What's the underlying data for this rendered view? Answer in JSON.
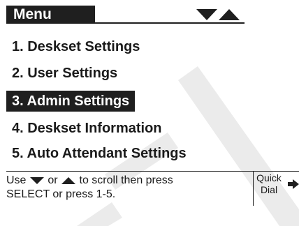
{
  "header": {
    "title": "Menu"
  },
  "menu": {
    "items": [
      {
        "label": "1. Deskset Settings",
        "selected": false
      },
      {
        "label": "2. User Settings",
        "selected": false
      },
      {
        "label": "3. Admin Settings",
        "selected": true
      },
      {
        "label": "4. Deskset Information",
        "selected": false
      },
      {
        "label": "5. Auto Attendant Settings",
        "selected": false
      }
    ]
  },
  "hint": {
    "use": "Use",
    "or": "or",
    "scroll": "to scroll then press",
    "line2": "SELECT or press 1-5."
  },
  "softkey": {
    "line1": "Quick",
    "line2": "Dial"
  }
}
